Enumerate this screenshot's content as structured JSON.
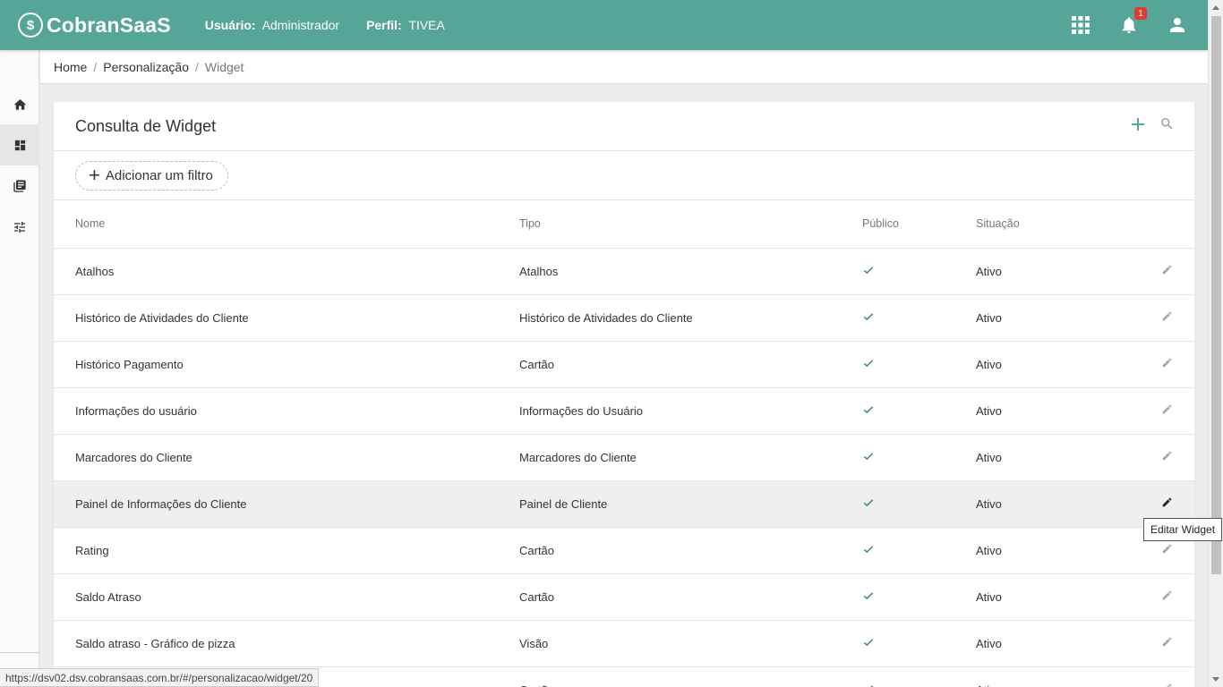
{
  "header": {
    "logo_text": "CobranSaaS",
    "user_label": "Usuário:",
    "user_value": "Administrador",
    "profile_label": "Perfil:",
    "profile_value": "TIVEA",
    "notification_count": "1"
  },
  "breadcrumb": {
    "home": "Home",
    "section": "Personalização",
    "current": "Widget",
    "separator": "/"
  },
  "card": {
    "title": "Consulta de Widget",
    "filter_button": "Adicionar um filtro"
  },
  "table": {
    "columns": [
      "Nome",
      "Tipo",
      "Público",
      "Situação"
    ],
    "rows": [
      {
        "nome": "Atalhos",
        "tipo": "Atalhos",
        "situacao": "Ativo"
      },
      {
        "nome": "Histórico de Atividades do Cliente",
        "tipo": "Histórico de Atividades do Cliente",
        "situacao": "Ativo"
      },
      {
        "nome": "Histórico Pagamento",
        "tipo": "Cartão",
        "situacao": "Ativo"
      },
      {
        "nome": "Informações do usuário",
        "tipo": "Informações do Usuário",
        "situacao": "Ativo"
      },
      {
        "nome": "Marcadores do Cliente",
        "tipo": "Marcadores do Cliente",
        "situacao": "Ativo"
      },
      {
        "nome": "Painel de Informações do Cliente",
        "tipo": "Painel de Cliente",
        "situacao": "Ativo"
      },
      {
        "nome": "Rating",
        "tipo": "Cartão",
        "situacao": "Ativo"
      },
      {
        "nome": "Saldo Atraso",
        "tipo": "Cartão",
        "situacao": "Ativo"
      },
      {
        "nome": "Saldo atraso - Gráfico de pizza",
        "tipo": "Visão",
        "situacao": "Ativo"
      },
      {
        "nome": "",
        "tipo": "Cartão",
        "situacao": "Ativo"
      }
    ]
  },
  "tooltip": "Editar Widget",
  "status_url": "https://dsv02.dsv.cobransaas.com.br/#/personalizacao/widget/20",
  "colors": {
    "topbar": "#55a699",
    "accent": "#55a699",
    "check": "#3e8e7e"
  }
}
